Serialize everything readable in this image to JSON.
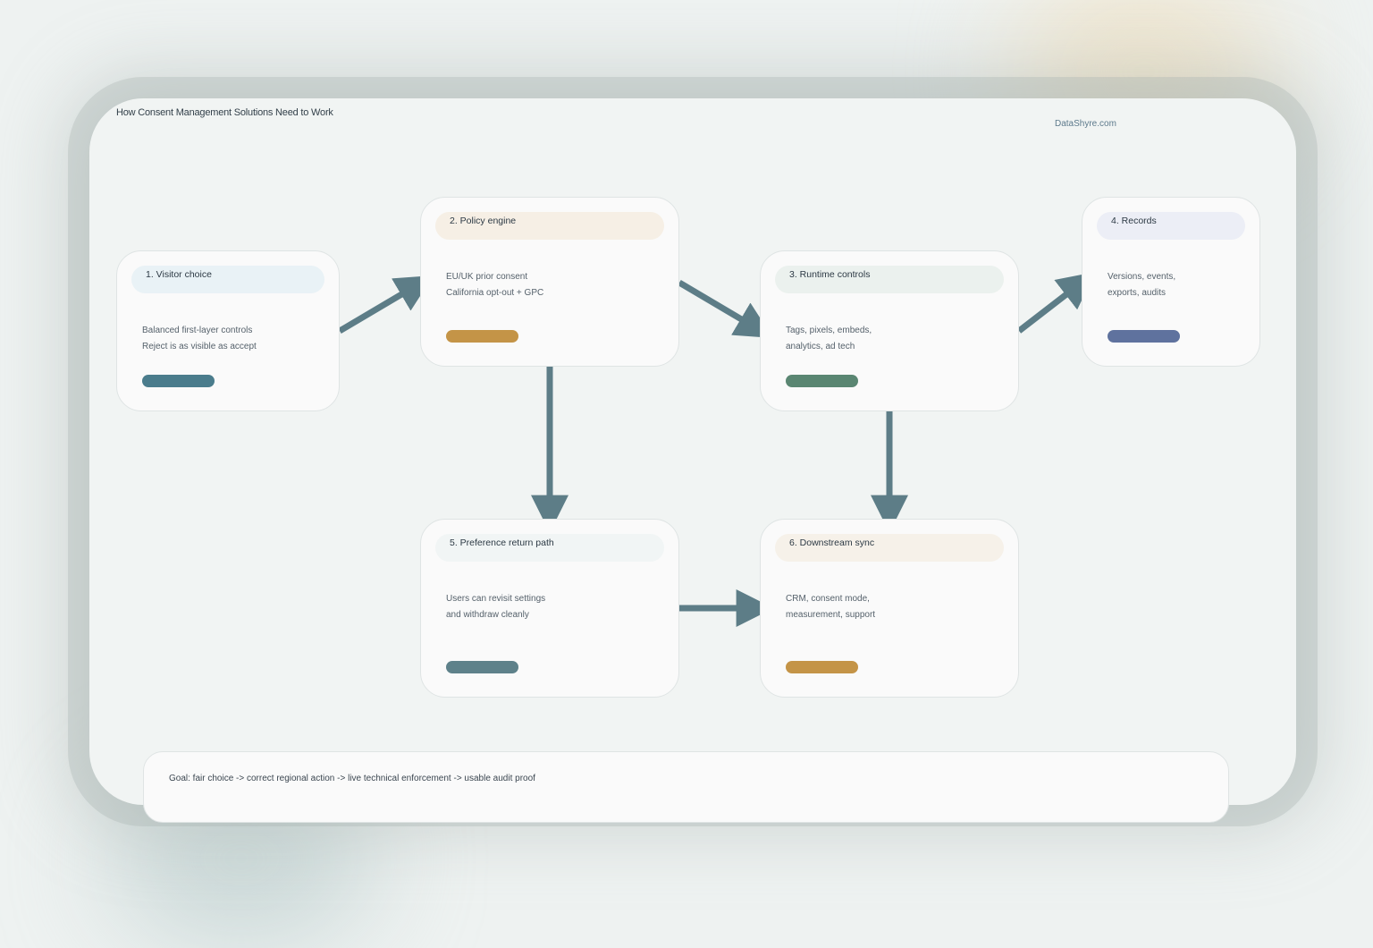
{
  "diagram": {
    "title": "How Consent Management Solutions Need to Work",
    "brand": "DataShyre.com",
    "steps": [
      {
        "title": "1. Visitor choice",
        "lines": [
          "Balanced first-layer controls",
          "Reject is as visible as accept"
        ],
        "header_color": "#e9f2f6",
        "pill_color": "#4a7c8c"
      },
      {
        "title": "2. Policy engine",
        "lines": [
          "EU/UK prior consent",
          "California opt-out + GPC"
        ],
        "header_color": "#f6efe5",
        "pill_color": "#c49447"
      },
      {
        "title": "3. Runtime controls",
        "lines": [
          "Tags, pixels, embeds,",
          "analytics, ad tech"
        ],
        "header_color": "#ebf1ee",
        "pill_color": "#5a8672"
      },
      {
        "title": "4. Records",
        "lines": [
          "Versions, events,",
          "exports, audits"
        ],
        "header_color": "#eceef6",
        "pill_color": "#5f729e"
      },
      {
        "title": "5. Preference return path",
        "lines": [
          "Users can revisit settings",
          "and withdraw cleanly"
        ],
        "header_color": "#f1f5f5",
        "pill_color": "#5e818a"
      },
      {
        "title": "6. Downstream sync",
        "lines": [
          "CRM, consent mode,",
          "measurement, support"
        ],
        "header_color": "#f6f1e9",
        "pill_color": "#c49447"
      }
    ],
    "goal": "Goal: fair choice -> correct regional action -> live technical enforcement -> usable audit proof",
    "arrow_color": "#5d7d87"
  }
}
